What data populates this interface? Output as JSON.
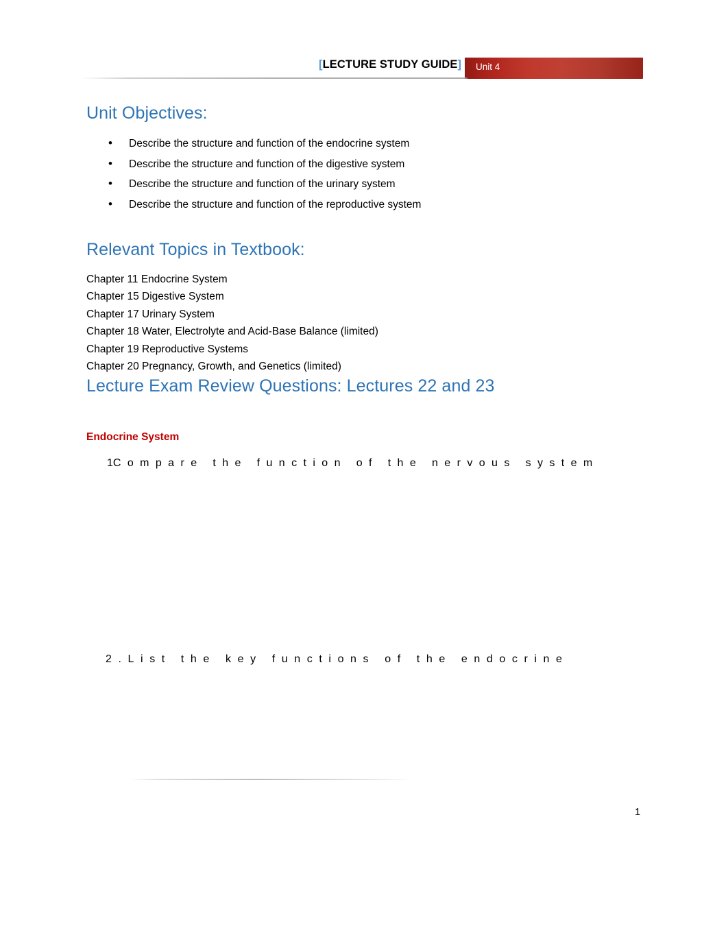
{
  "header": {
    "title_open_bracket": "[",
    "title_inner": "LECTURE STUDY GUIDE",
    "title_close_bracket": "]",
    "tab_label": "Unit 4",
    "tab_color": "#b03a2d",
    "bracket_color": "#5b9bd5"
  },
  "document": {
    "objectives": {
      "heading": "Unit Objectives:",
      "items": [
        "Describe the structure and function of the endocrine system",
        "Describe the structure and function of the digestive system",
        "Describe the structure and function of the urinary system",
        "Describe the structure and function of the reproductive system"
      ]
    },
    "topics": {
      "heading": "Relevant Topics in Textbook:",
      "lines": [
        "Chapter 11 Endocrine System",
        "Chapter 15 Digestive System",
        "Chapter 17 Urinary System",
        "Chapter 18 Water, Electrolyte and Acid-Base Balance (limited)",
        "Chapter 19 Reproductive Systems",
        "Chapter 20 Pregnancy, Growth, and Genetics (limited)"
      ]
    },
    "exam_review": {
      "heading": "Lecture Exam Review Questions: Lectures 22 and 23",
      "subsection_heading": "Endocrine System",
      "heading_color": "#2e74b5",
      "subsection_color": "#c00000",
      "questions": [
        {
          "number": "1",
          "text": "Compare the function of the nervous system"
        },
        {
          "number": "2.",
          "text": "List the key functions of the endocrine"
        }
      ]
    },
    "footer": {
      "page_number": "1"
    }
  }
}
